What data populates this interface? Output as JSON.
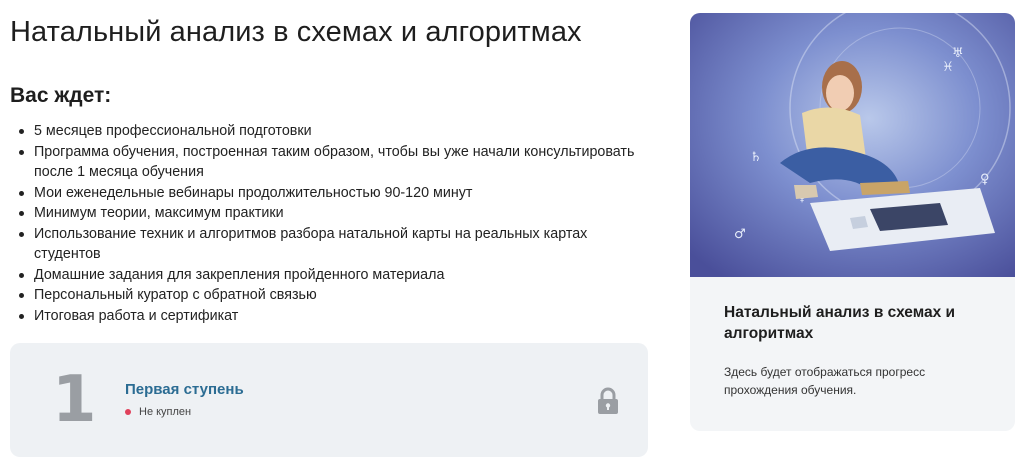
{
  "header": {
    "title": "Натальный анализ в схемах и алгоритмах"
  },
  "intro": {
    "subtitle": "Вас ждет:"
  },
  "features": [
    "5 месяцев профессиональной подготовки",
    "Программа обучения, построенная таким образом, чтобы вы уже начали консультировать после 1 месяца обучения",
    "Мои еженедельные вебинары продолжительностью 90-120 минут",
    "Минимум теории, максимум практики",
    "Использование техник и алгоритмов разбора натальной карты на реальных картах студентов",
    "Домашние задания для закрепления пройденного материала",
    "Персональный куратор с обратной связью",
    "Итоговая работа и сертификат"
  ],
  "step": {
    "number": "1",
    "title": "Первая ступень",
    "status": "Не куплен",
    "status_color": "#e0415b",
    "icon": "lock-icon"
  },
  "course_card": {
    "image": "woman-assembling-natal-chart-puzzle",
    "title": "Натальный анализ в схемах и алгоритмах",
    "note": "Здесь будет отображаться прогресс прохождения обучения."
  },
  "colors": {
    "accent_link": "#2b6c93",
    "card_bg": "#eef1f4",
    "step_number": "#9a9ea3"
  }
}
